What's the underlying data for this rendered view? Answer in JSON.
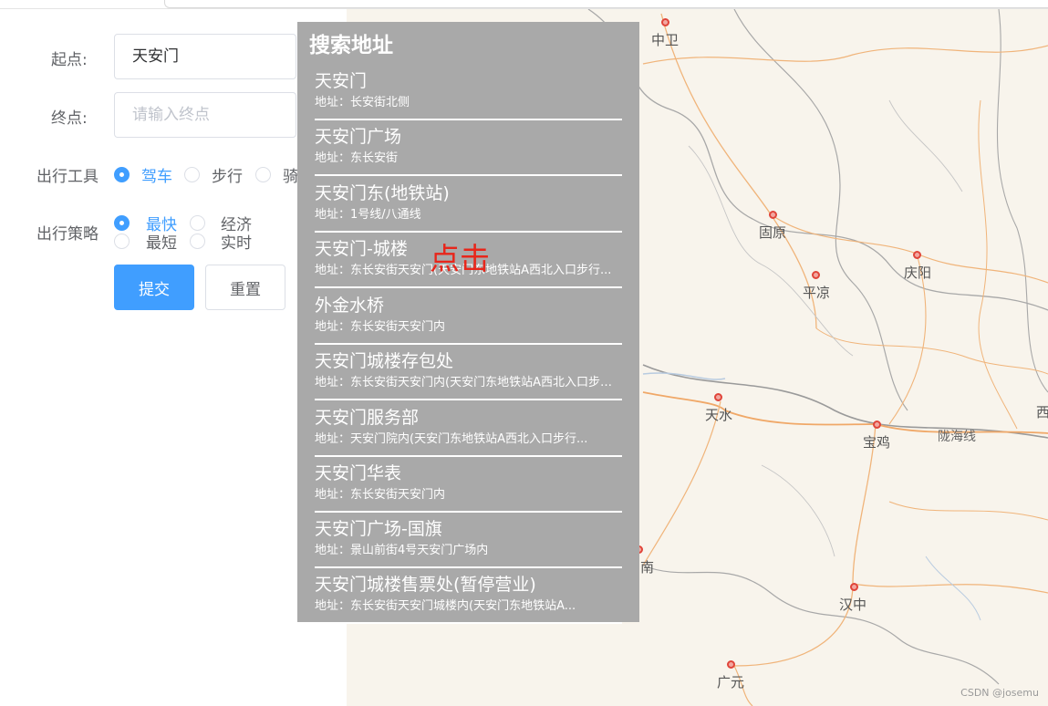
{
  "form": {
    "start_label": "起点:",
    "start_value": "天安门",
    "end_label": "终点:",
    "end_placeholder": "请输入终点",
    "mode_label": "出行工具",
    "modes": [
      {
        "label": "驾车",
        "selected": true
      },
      {
        "label": "步行",
        "selected": false
      },
      {
        "label": "骑",
        "selected": false
      }
    ],
    "policy_label": "出行策略",
    "policies": [
      {
        "label": "最快",
        "selected": true
      },
      {
        "label": "经济",
        "selected": false
      },
      {
        "label": "最短",
        "selected": false
      },
      {
        "label": "实时",
        "selected": false
      }
    ],
    "submit_label": "提交",
    "reset_label": "重置"
  },
  "search": {
    "title": "搜索地址",
    "results": [
      {
        "name": "天安门",
        "address": "地址：长安街北侧"
      },
      {
        "name": "天安门广场",
        "address": "地址：东长安街"
      },
      {
        "name": "天安门东(地铁站)",
        "address": "地址：1号线/八通线"
      },
      {
        "name": "天安门-城楼",
        "address": "地址：东长安街天安门(天安门东地铁站A西北入口步行..."
      },
      {
        "name": "外金水桥",
        "address": "地址：东长安街天安门内"
      },
      {
        "name": "天安门城楼存包处",
        "address": "地址：东长安街天安门内(天安门东地铁站A西北入口步行..."
      },
      {
        "name": "天安门服务部",
        "address": "地址：天安门院内(天安门东地铁站A西北入口步行..."
      },
      {
        "name": "天安门华表",
        "address": "地址：东长安街天安门内"
      },
      {
        "name": "天安门广场-国旗",
        "address": "地址：景山前街4号天安门广场内"
      },
      {
        "name": "天安门城楼售票处(暂停营业)",
        "address": "地址：东长安街天安门城楼内(天安门东地铁站A..."
      }
    ]
  },
  "annotation": "点击",
  "map": {
    "cities": [
      "中卫",
      "固原",
      "庆阳",
      "平凉",
      "天水",
      "宝鸡",
      "汉中",
      "广元",
      "南",
      "西"
    ],
    "road_label": "陇海线",
    "watermark": "CSDN @josemu"
  },
  "colors": {
    "accent": "#409eff",
    "panel": "#a9a9a9",
    "annotation": "#e8261b"
  }
}
